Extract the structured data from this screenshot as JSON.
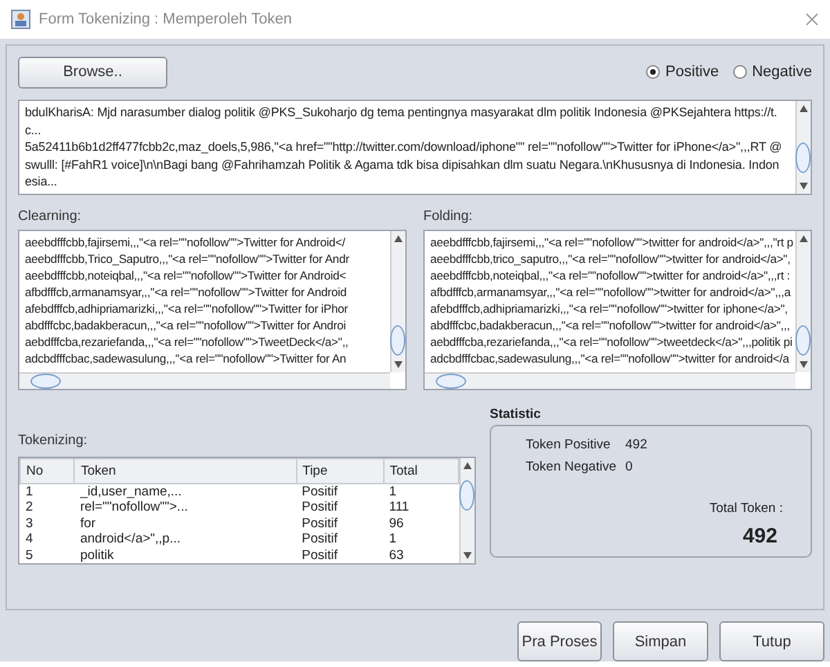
{
  "window": {
    "title": "Form Tokenizing : Memperoleh Token"
  },
  "browse_button": "Browse..",
  "radios": [
    {
      "label": "Positive",
      "selected": true
    },
    {
      "label": "Negative",
      "selected": false
    }
  ],
  "input_text": {
    "lines": [
      "bdulKharisA: Mjd narasumber dialog politik @PKS_Sukoharjo dg tema pentingnya masyarakat dlm politik Indonesia @PKSejahtera https://t.",
      "c...",
      "5a52411b6b1d2ff477fcbb2c,maz_doels,5,986,\"<a href=\"\"http://twitter.com/download/iphone\"\" rel=\"\"nofollow\"\">Twitter for iPhone</a>\",,,RT @",
      "swulll: [#FahR1 voice]\\n\\nBagi bang @Fahrihamzah Politik & Agama tdk bisa dipisahkan dlm suatu Negara.\\nKhususnya di Indonesia. Indon",
      "esia..."
    ]
  },
  "cleaning": {
    "label": "Clearning:",
    "lines": [
      "aeebdfffcbb,fajirsemi,,,\"<a rel=\"\"nofollow\"\">Twitter for Android</",
      "aeebdfffcbb,Trico_Saputro,,,\"<a rel=\"\"nofollow\"\">Twitter for Andr",
      "aeebdfffcbb,noteiqbal,,,\"<a rel=\"\"nofollow\"\">Twitter for Android<",
      "afbdfffcb,armanamsyar,,,\"<a rel=\"\"nofollow\"\">Twitter for Android",
      "afebdfffcb,adhipriamarizki,,,\"<a rel=\"\"nofollow\"\">Twitter for iPhor",
      "abdfffcbc,badakberacun,,,\"<a rel=\"\"nofollow\"\">Twitter for Androi",
      "aebdfffcba,rezariefanda,,,\"<a rel=\"\"nofollow\"\">TweetDeck</a>\",,",
      "adcbdfffcbac,sadewasulung,,,\"<a rel=\"\"nofollow\"\">Twitter for An"
    ]
  },
  "folding": {
    "label": "Folding:",
    "lines": [
      "aeebdfffcbb,fajirsemi,,,\"<a rel=\"\"nofollow\"\">twitter for android</a>\",,,\"rt p",
      "aeebdfffcbb,trico_saputro,,,\"<a rel=\"\"nofollow\"\">twitter for android</a>\",",
      "aeebdfffcbb,noteiqbal,,,\"<a rel=\"\"nofollow\"\">twitter for android</a>\",,,rt :",
      "afbdfffcb,armanamsyar,,,\"<a rel=\"\"nofollow\"\">twitter for android</a>\",,,a",
      "afebdfffcb,adhipriamarizki,,,\"<a rel=\"\"nofollow\"\">twitter for iphone</a>\",",
      "abdfffcbc,badakberacun,,,\"<a rel=\"\"nofollow\"\">twitter for android</a>\",,,",
      "aebdfffcba,rezariefanda,,,\"<a rel=\"\"nofollow\"\">tweetdeck</a>\",,,politik pi",
      "adcbdfffcbac,sadewasulung,,,\"<a rel=\"\"nofollow\"\">twitter for android</a"
    ]
  },
  "tokenizing": {
    "label": "Tokenizing:",
    "columns": [
      "No",
      "Token",
      "Tipe",
      "Total"
    ],
    "rows": [
      [
        "1",
        "_id,user_name,...",
        "Positif",
        "1"
      ],
      [
        "2",
        "rel=\"\"nofollow\"\">...",
        "Positif",
        "111"
      ],
      [
        "3",
        "for",
        "Positif",
        "96"
      ],
      [
        "4",
        "android</a>\",,p...",
        "Positif",
        "1"
      ],
      [
        "5",
        "politik",
        "Positif",
        "63"
      ]
    ]
  },
  "statistic": {
    "title": "Statistic",
    "rows": [
      {
        "label": "Token Positive",
        "value": "492"
      },
      {
        "label": "Token Negative",
        "value": "0"
      }
    ],
    "total_label": "Total Token :",
    "total_value": "492"
  },
  "buttons": [
    "Pra Proses",
    "Simpan",
    "Tutup"
  ]
}
